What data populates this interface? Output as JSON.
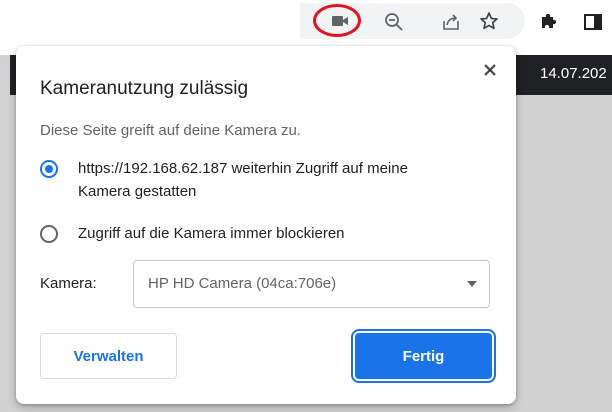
{
  "toolbar": {
    "icons": [
      "camera-icon",
      "zoom-out-icon",
      "share-icon",
      "star-icon",
      "extensions-icon",
      "side-panel-icon"
    ],
    "highlight_color": "#e0141e"
  },
  "page": {
    "date_text": "14.07.202"
  },
  "bubble": {
    "title": "Kameranutzung zulässig",
    "description": "Diese Seite greift auf deine Kamera zu.",
    "options": [
      {
        "label": "https://192.168.62.187 weiterhin Zugriff auf meine Kamera gestatten",
        "selected": true
      },
      {
        "label": "Zugriff auf die Kamera immer blockieren",
        "selected": false
      }
    ],
    "camera_label": "Kamera:",
    "camera_selected": "HP HD Camera (04ca:706e)",
    "manage_label": "Verwalten",
    "done_label": "Fertig"
  },
  "colors": {
    "accent": "#1a73e8",
    "text": "#202124",
    "secondary_text": "#5f6368"
  }
}
